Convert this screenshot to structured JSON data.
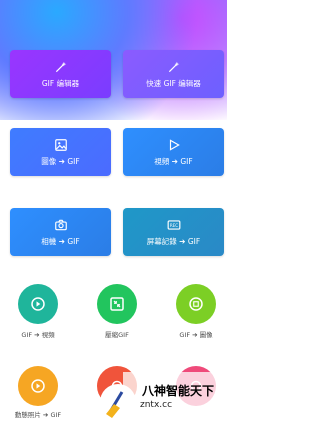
{
  "cards": [
    {
      "label": "GIF 编辑器",
      "icon": "wand-icon"
    },
    {
      "label": "快速 GIF 编辑器",
      "icon": "wand-icon"
    },
    {
      "label": "圖像 ➔ GIF",
      "icon": "image-icon"
    },
    {
      "label": "視頻 ➔ GIF",
      "icon": "play-icon"
    },
    {
      "label": "相機 ➔ GIF",
      "icon": "camera-icon"
    },
    {
      "label": "屏幕記錄 ➔ GIF",
      "icon": "rec-icon"
    }
  ],
  "circles": [
    {
      "label": "GIF ➔ 視頻",
      "color": "#1fb59b",
      "icon": "video-circle-icon"
    },
    {
      "label": "壓縮GIF",
      "color": "#22c55e",
      "icon": "compress-icon"
    },
    {
      "label": "GIF ➔ 圖像",
      "color": "#7ccf25",
      "icon": "image-convert-icon"
    },
    {
      "label": "動態照片 ➔ GIF",
      "color": "#f6a623",
      "icon": "live-photo-icon"
    },
    {
      "label": "",
      "color": "#f0543b",
      "icon": "tool-icon"
    },
    {
      "label": "",
      "color": "#ef4a7a",
      "icon": "tool-icon"
    }
  ],
  "watermark": {
    "title": "八神智能天下",
    "url": "zntx.cc"
  }
}
